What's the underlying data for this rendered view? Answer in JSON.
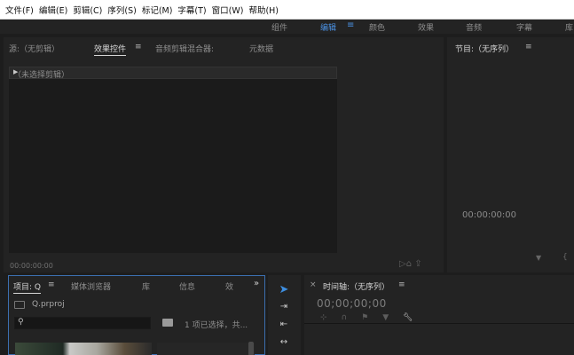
{
  "menu": [
    "文件(F)",
    "编辑(E)",
    "剪辑(C)",
    "序列(S)",
    "标记(M)",
    "字幕(T)",
    "窗口(W)",
    "帮助(H)"
  ],
  "workspaces": {
    "zujian": "组件",
    "bianji": "编辑",
    "yanse": "颜色",
    "xiaoguo": "效果",
    "yinpin": "音频",
    "zimu": "字幕",
    "ku": "库"
  },
  "source_panel": {
    "tabs": [
      "源:（无剪辑）",
      "效果控件",
      "音频剪辑混合器:",
      "元数据"
    ],
    "clip_label": "（未选择剪辑）",
    "timecode": "00:00:00:00"
  },
  "program_panel": {
    "title": "节目:（无序列）",
    "timecode": "00:00:00:00"
  },
  "project_panel": {
    "tabs": [
      "项目: Q",
      "媒体浏览器",
      "库",
      "信息",
      "效"
    ],
    "file_name": "Q.prproj",
    "selection_info": "1 项已选择，共..."
  },
  "timeline_panel": {
    "title": "时间轴:（无序列）",
    "timecode": "00;00;00;00"
  },
  "icons": {
    "menu": "hamburger-icon",
    "search": "magnifier-icon",
    "selection_tool": "arrow-cursor-icon",
    "wrench": "wrench-icon"
  },
  "colors": {
    "accent": "#4a90e2",
    "panel_bg": "#232323",
    "app_bg": "#1d1d1d"
  }
}
